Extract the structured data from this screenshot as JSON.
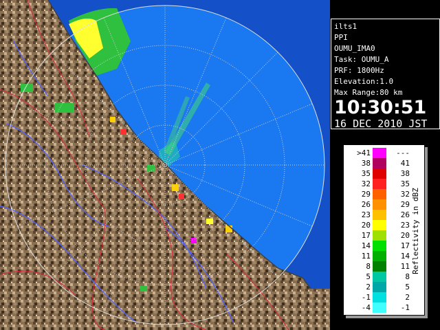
{
  "info": {
    "radar_name": "ilts1",
    "scan_type": "PPI",
    "site": "OUMU_IMA0",
    "task": "Task: OUMU_A",
    "prf": "PRF: 1800Hz",
    "elevation": "Elevation:1.0",
    "max_range": "Max Range:80 km",
    "time": "10:30:51",
    "date": "16 DEC 2010 JST"
  },
  "legend": {
    "title": "Reflectivity in dBZ",
    "rows": [
      {
        "low": ">41",
        "high": "---",
        "color": "#ff00ff"
      },
      {
        "low": "38",
        "high": "41",
        "color": "#b00060"
      },
      {
        "low": "35",
        "high": "38",
        "color": "#e00000"
      },
      {
        "low": "32",
        "high": "35",
        "color": "#ff2020"
      },
      {
        "low": "29",
        "high": "32",
        "color": "#ff6000"
      },
      {
        "low": "26",
        "high": "29",
        "color": "#ff9000"
      },
      {
        "low": "23",
        "high": "26",
        "color": "#ffc000"
      },
      {
        "low": "20",
        "high": "23",
        "color": "#ffff00"
      },
      {
        "low": "17",
        "high": "20",
        "color": "#a0e000"
      },
      {
        "low": "14",
        "high": "17",
        "color": "#00e000"
      },
      {
        "low": "11",
        "high": "14",
        "color": "#00b000"
      },
      {
        "low": "8",
        "high": "11",
        "color": "#008000"
      },
      {
        "low": "5",
        "high": "8",
        "color": "#00c8a0"
      },
      {
        "low": "2",
        "high": "5",
        "color": "#00a8a8"
      },
      {
        "low": "-1",
        "high": "2",
        "color": "#00e0e0"
      },
      {
        "low": "-4",
        "high": "-1",
        "color": "#40ffff"
      }
    ]
  },
  "colors": {
    "sea": "#1a78f0",
    "sea_dark": "#1450c8",
    "land": "#8a7050",
    "border_red": "#d03040",
    "river_blue": "#5060ff",
    "range_ring": "#d0d0d0"
  }
}
